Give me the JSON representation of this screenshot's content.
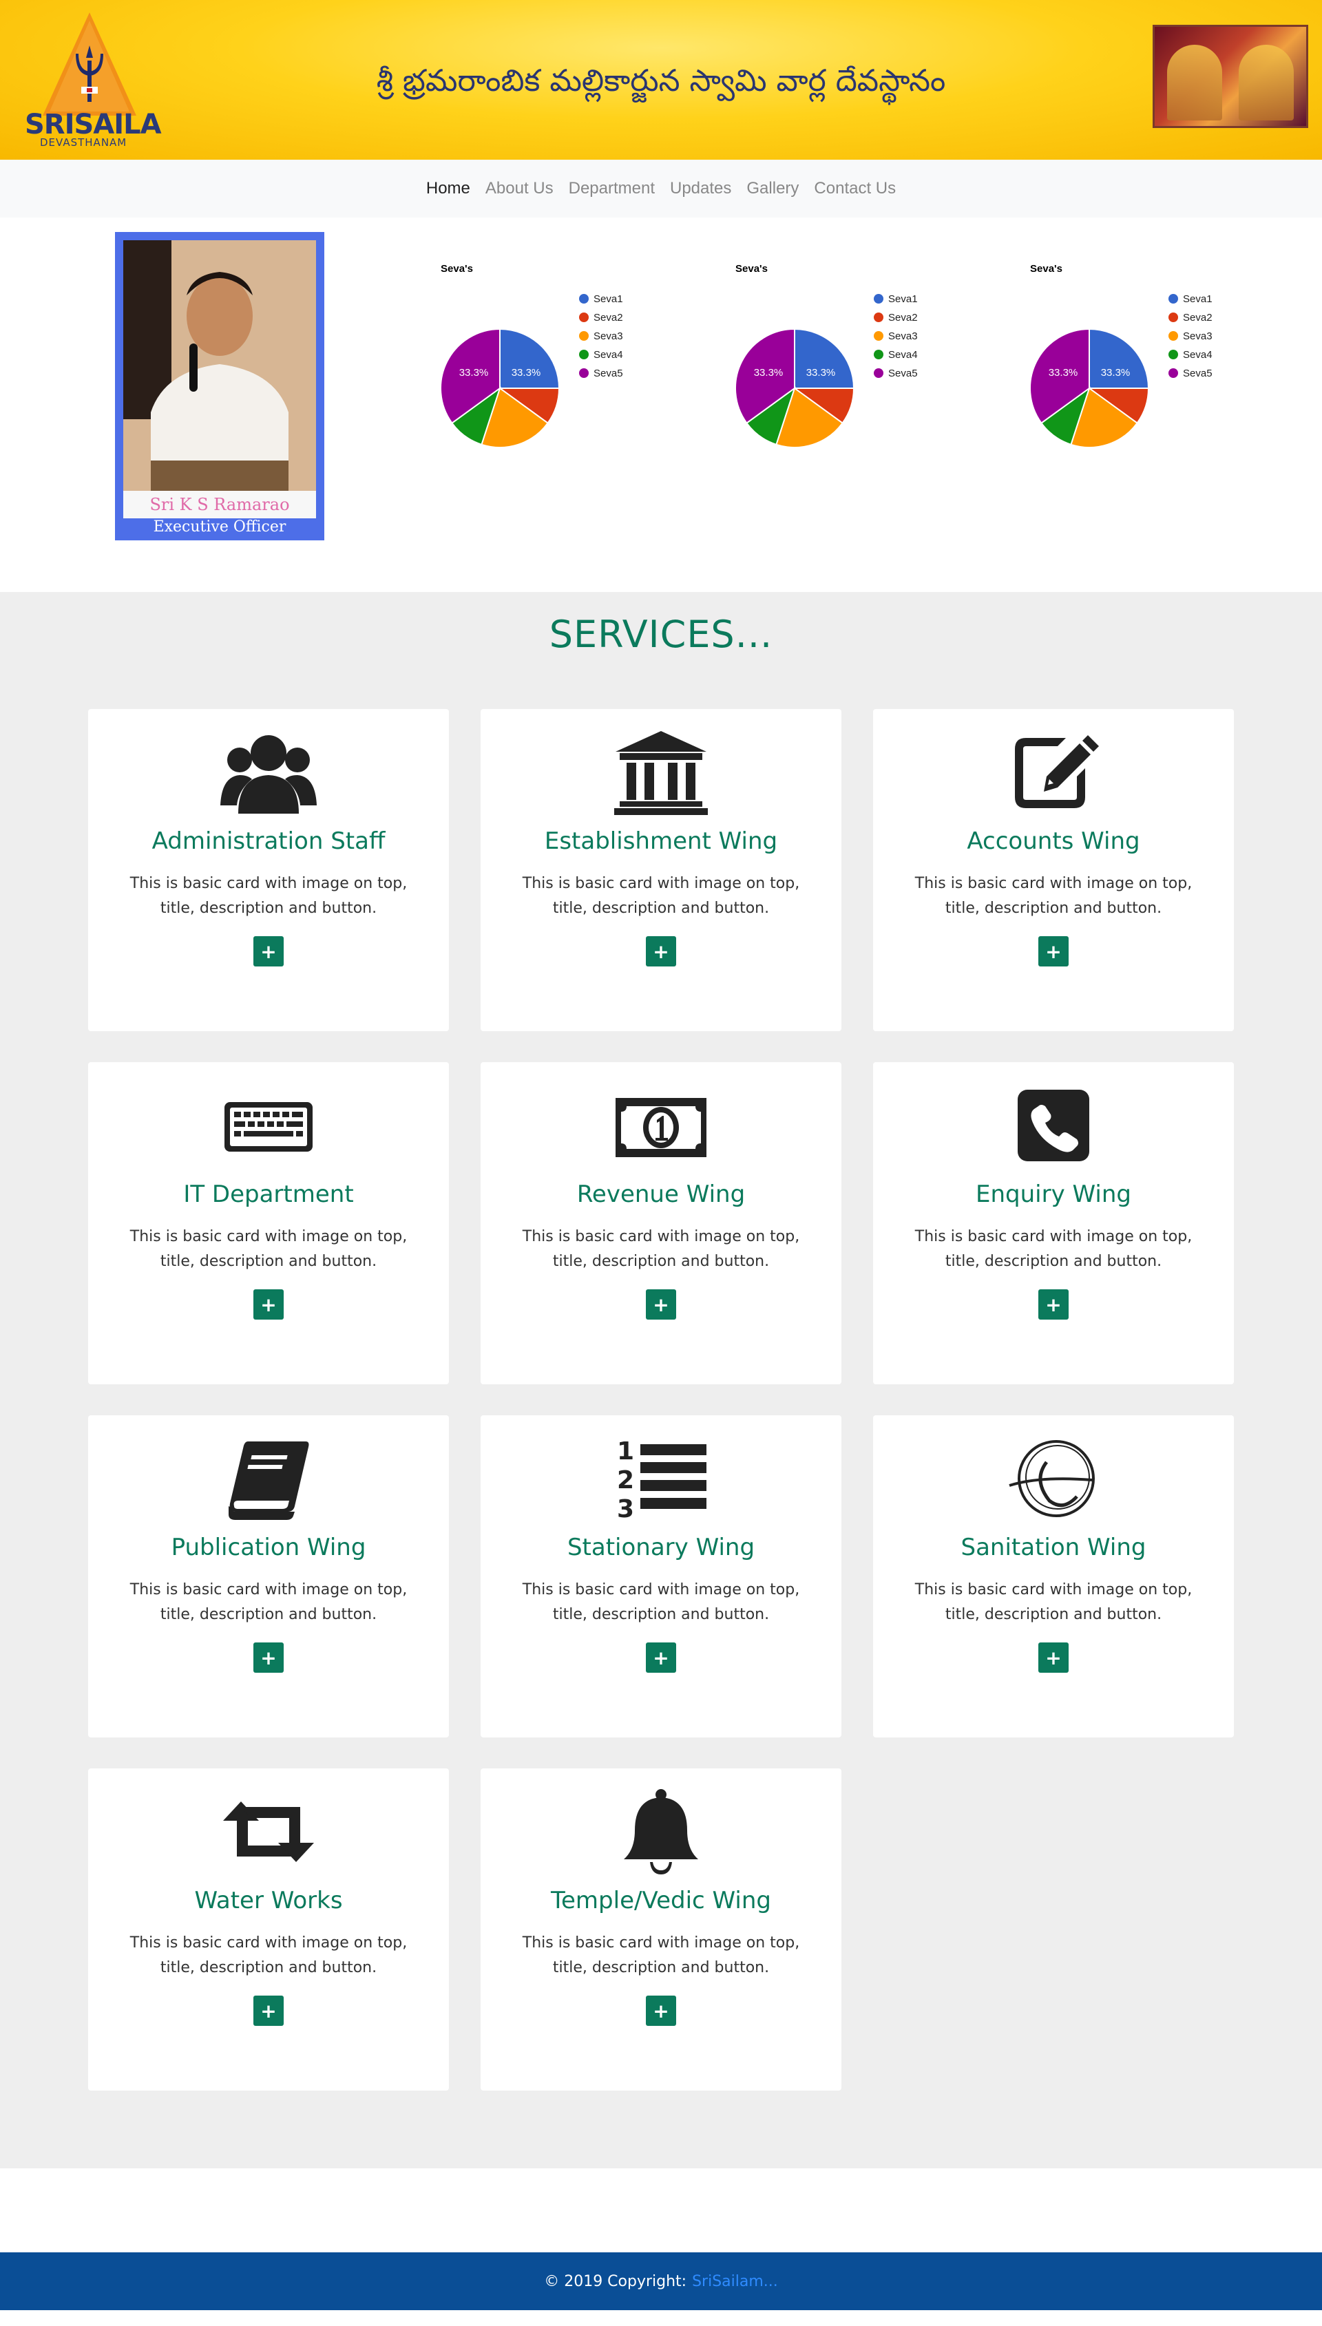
{
  "header": {
    "logo_text": "SRISAILA",
    "logo_sub": "DEVASTHANAM",
    "title": "శ్రీ భ్రమరాంబిక మల్లికార్జున స్వామి వార్ల దేవస్థానం"
  },
  "nav": {
    "items": [
      "Home",
      "About Us",
      "Department",
      "Updates",
      "Gallery",
      "Contact Us"
    ]
  },
  "officer": {
    "name": "Sri K S Ramarao",
    "role": "Executive Officer"
  },
  "chart_data": [
    {
      "type": "pie",
      "title": "Seva's",
      "categories": [
        "Seva1",
        "Seva2",
        "Seva3",
        "Seva4",
        "Seva5"
      ],
      "values": [
        25,
        10,
        20,
        10,
        35
      ],
      "data_labels": [
        "33.3%",
        "33.3%"
      ],
      "colors": [
        "#3366cc",
        "#dc3912",
        "#ff9900",
        "#109618",
        "#990099"
      ],
      "legend": "right"
    },
    {
      "type": "pie",
      "title": "Seva's",
      "categories": [
        "Seva1",
        "Seva2",
        "Seva3",
        "Seva4",
        "Seva5"
      ],
      "values": [
        25,
        10,
        20,
        10,
        35
      ],
      "data_labels": [
        "33.3%",
        "33.3%"
      ],
      "colors": [
        "#3366cc",
        "#dc3912",
        "#ff9900",
        "#109618",
        "#990099"
      ],
      "legend": "right"
    },
    {
      "type": "pie",
      "title": "Seva's",
      "categories": [
        "Seva1",
        "Seva2",
        "Seva3",
        "Seva4",
        "Seva5"
      ],
      "values": [
        25,
        10,
        20,
        10,
        35
      ],
      "data_labels": [
        "33.3%",
        "33.3%"
      ],
      "colors": [
        "#3366cc",
        "#dc3912",
        "#ff9900",
        "#109618",
        "#990099"
      ],
      "legend": "right"
    }
  ],
  "services": {
    "title": "SERVICES...",
    "cards": [
      {
        "title": "Administration Staff",
        "desc": "This is basic card with image on top, title, description and button.",
        "icon": "users-icon",
        "btn": "+"
      },
      {
        "title": "Establishment Wing",
        "desc": "This is basic card with image on top, title, description and button.",
        "icon": "institution-icon",
        "btn": "+"
      },
      {
        "title": "Accounts Wing",
        "desc": "This is basic card with image on top, title, description and button.",
        "icon": "edit-icon",
        "btn": "+"
      },
      {
        "title": "IT Department",
        "desc": "This is basic card with image on top, title, description and button.",
        "icon": "keyboard-icon",
        "btn": "+"
      },
      {
        "title": "Revenue Wing",
        "desc": "This is basic card with image on top, title, description and button.",
        "icon": "money-icon",
        "btn": "+"
      },
      {
        "title": "Enquiry Wing",
        "desc": "This is basic card with image on top, title, description and button.",
        "icon": "phone-icon",
        "btn": "+"
      },
      {
        "title": "Publication Wing",
        "desc": "This is basic card with image on top, title, description and button.",
        "icon": "book-icon",
        "btn": "+"
      },
      {
        "title": "Stationary Wing",
        "desc": "This is basic card with image on top, title, description and button.",
        "icon": "list-ol-icon",
        "btn": "+"
      },
      {
        "title": "Sanitation Wing",
        "desc": "This is basic card with image on top, title, description and button.",
        "icon": "sanitation-logo-icon",
        "btn": "+"
      },
      {
        "title": "Water Works",
        "desc": "This is basic card with image on top, title, description and button.",
        "icon": "retweet-icon",
        "btn": "+"
      },
      {
        "title": "Temple/Vedic Wing",
        "desc": "This is basic card with image on top, title, description and button.",
        "icon": "bell-icon",
        "btn": "+"
      }
    ]
  },
  "footer": {
    "copyright": "© 2019 Copyright:",
    "link": "SriSailam..."
  }
}
